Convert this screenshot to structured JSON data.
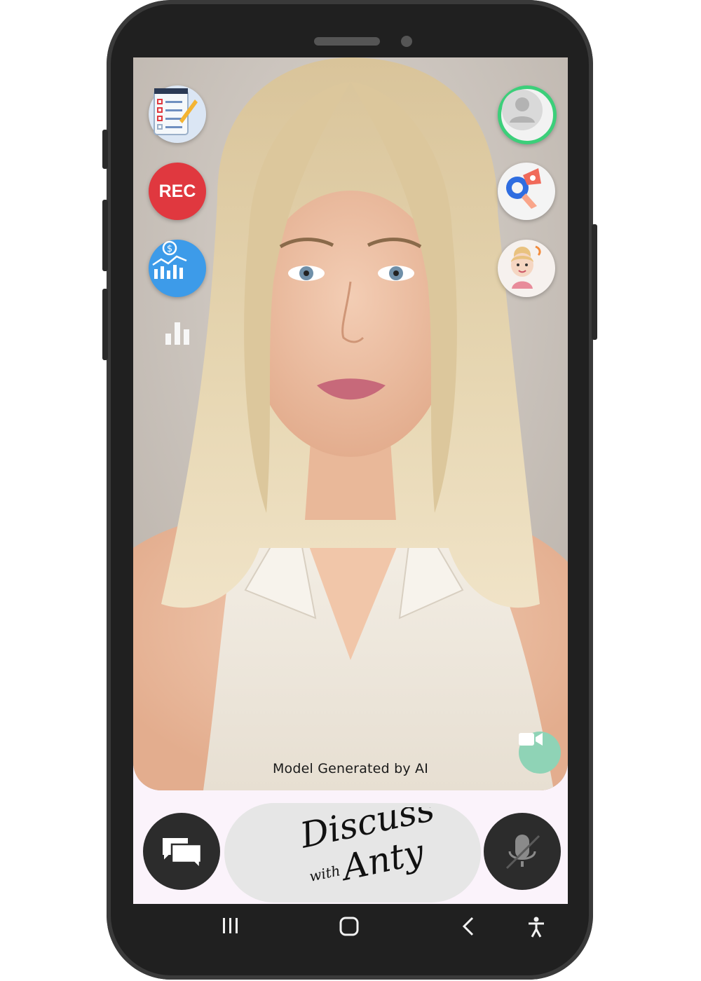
{
  "overlay": {
    "rec_label": "REC",
    "caption": "Model Generated by AI"
  },
  "bottom": {
    "title_line1": "Discuss",
    "title_line2_small": "with",
    "title_line2": "Anty"
  },
  "colors": {
    "rec_red": "#e0383f",
    "profile_ring": "#3ccf7a",
    "video_btn": "#8fd3b6",
    "finance_blue": "#3d9be9",
    "dark_button": "#2c2c2c",
    "pill_bg": "#e6e6e6"
  },
  "icons": {
    "left": [
      "notepad-checklist-icon",
      "rec-icon",
      "finance-chart-icon",
      "bar-chart-icon"
    ],
    "right": [
      "profile-avatar-icon",
      "megaphone-icon",
      "avatar-girl-icon"
    ],
    "video": "video-camera-icon",
    "chat": "chat-bubbles-icon",
    "mic": "microphone-muted-icon",
    "nav": [
      "recent-apps-icon",
      "home-icon",
      "back-icon",
      "accessibility-icon"
    ]
  }
}
